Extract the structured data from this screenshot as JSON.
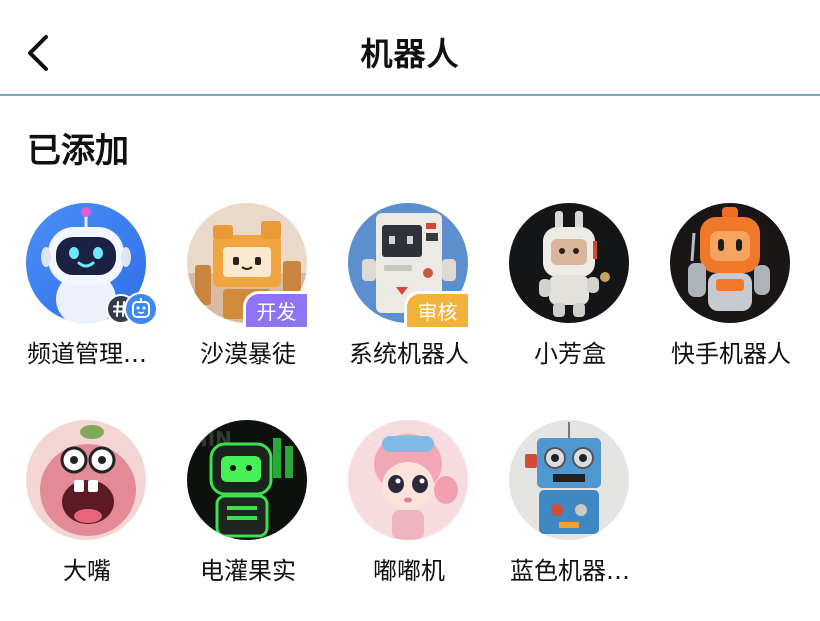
{
  "header": {
    "title": "机器人",
    "back_icon": "chevron-left-icon"
  },
  "section": {
    "title": "已添加"
  },
  "bots": [
    {
      "name": "频道管理…",
      "badge": "",
      "avatar": "white-blue-robot-avatar",
      "badge_icons": [
        "hash-icon",
        "bot-icon"
      ]
    },
    {
      "name": "沙漠暴徒",
      "badge": "开发",
      "avatar": "orange-box-robot-avatar"
    },
    {
      "name": "系统机器人",
      "badge": "审核",
      "avatar": "white-computer-robot-avatar"
    },
    {
      "name": "小芳盒",
      "badge": "",
      "avatar": "white-astronaut-robot-avatar"
    },
    {
      "name": "快手机器人",
      "badge": "",
      "avatar": "orange-astronaut-robot-avatar"
    },
    {
      "name": "大嘴",
      "badge": "",
      "avatar": "pink-bigmouth-monster-avatar"
    },
    {
      "name": "电灌果实",
      "badge": "",
      "avatar": "green-neon-robot-avatar"
    },
    {
      "name": "嘟嘟机",
      "badge": "",
      "avatar": "pink-girl-character-avatar"
    },
    {
      "name": "蓝色机器…",
      "badge": "",
      "avatar": "blue-retro-robot-avatar"
    }
  ],
  "colors": {
    "divider": "#7fa5c9",
    "dev_badge": "#8e74f3",
    "review_badge": "#f2b23c",
    "bot_badge": "#3d88f5"
  }
}
